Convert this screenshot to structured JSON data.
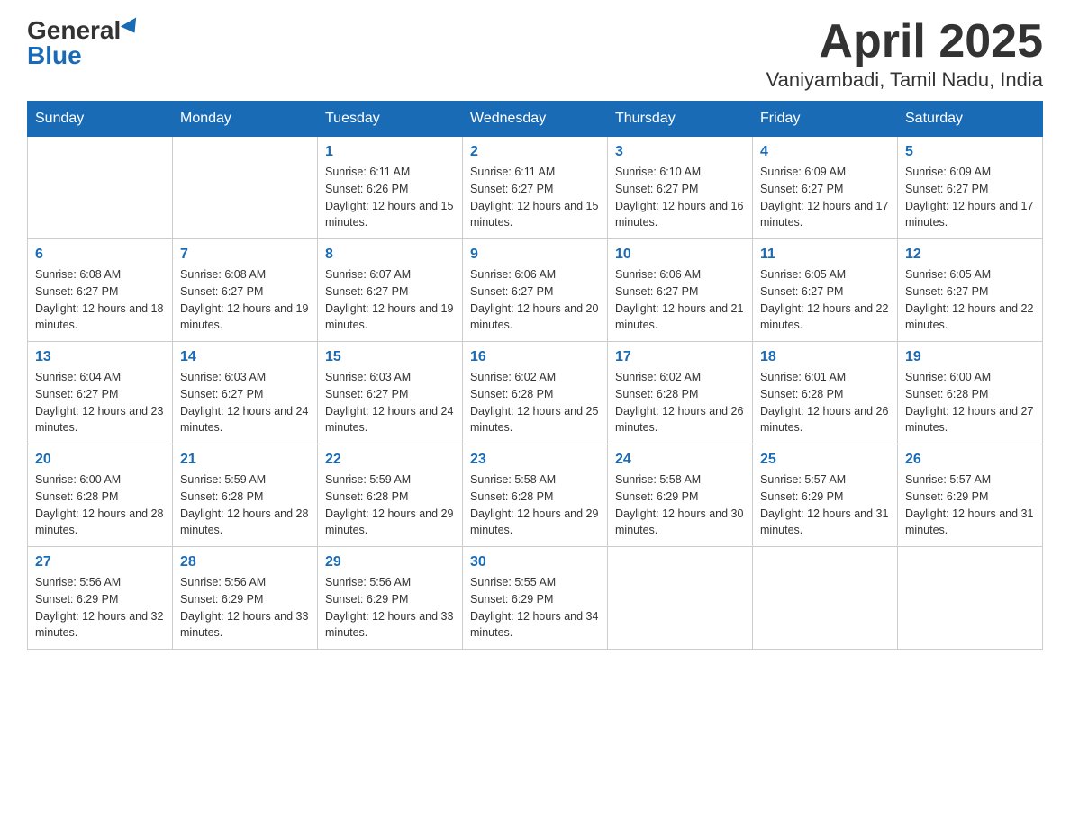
{
  "header": {
    "logo_general": "General",
    "logo_blue": "Blue",
    "month": "April 2025",
    "location": "Vaniyambadi, Tamil Nadu, India"
  },
  "weekdays": [
    "Sunday",
    "Monday",
    "Tuesday",
    "Wednesday",
    "Thursday",
    "Friday",
    "Saturday"
  ],
  "weeks": [
    [
      {
        "day": "",
        "sunrise": "",
        "sunset": "",
        "daylight": ""
      },
      {
        "day": "",
        "sunrise": "",
        "sunset": "",
        "daylight": ""
      },
      {
        "day": "1",
        "sunrise": "Sunrise: 6:11 AM",
        "sunset": "Sunset: 6:26 PM",
        "daylight": "Daylight: 12 hours and 15 minutes."
      },
      {
        "day": "2",
        "sunrise": "Sunrise: 6:11 AM",
        "sunset": "Sunset: 6:27 PM",
        "daylight": "Daylight: 12 hours and 15 minutes."
      },
      {
        "day": "3",
        "sunrise": "Sunrise: 6:10 AM",
        "sunset": "Sunset: 6:27 PM",
        "daylight": "Daylight: 12 hours and 16 minutes."
      },
      {
        "day": "4",
        "sunrise": "Sunrise: 6:09 AM",
        "sunset": "Sunset: 6:27 PM",
        "daylight": "Daylight: 12 hours and 17 minutes."
      },
      {
        "day": "5",
        "sunrise": "Sunrise: 6:09 AM",
        "sunset": "Sunset: 6:27 PM",
        "daylight": "Daylight: 12 hours and 17 minutes."
      }
    ],
    [
      {
        "day": "6",
        "sunrise": "Sunrise: 6:08 AM",
        "sunset": "Sunset: 6:27 PM",
        "daylight": "Daylight: 12 hours and 18 minutes."
      },
      {
        "day": "7",
        "sunrise": "Sunrise: 6:08 AM",
        "sunset": "Sunset: 6:27 PM",
        "daylight": "Daylight: 12 hours and 19 minutes."
      },
      {
        "day": "8",
        "sunrise": "Sunrise: 6:07 AM",
        "sunset": "Sunset: 6:27 PM",
        "daylight": "Daylight: 12 hours and 19 minutes."
      },
      {
        "day": "9",
        "sunrise": "Sunrise: 6:06 AM",
        "sunset": "Sunset: 6:27 PM",
        "daylight": "Daylight: 12 hours and 20 minutes."
      },
      {
        "day": "10",
        "sunrise": "Sunrise: 6:06 AM",
        "sunset": "Sunset: 6:27 PM",
        "daylight": "Daylight: 12 hours and 21 minutes."
      },
      {
        "day": "11",
        "sunrise": "Sunrise: 6:05 AM",
        "sunset": "Sunset: 6:27 PM",
        "daylight": "Daylight: 12 hours and 22 minutes."
      },
      {
        "day": "12",
        "sunrise": "Sunrise: 6:05 AM",
        "sunset": "Sunset: 6:27 PM",
        "daylight": "Daylight: 12 hours and 22 minutes."
      }
    ],
    [
      {
        "day": "13",
        "sunrise": "Sunrise: 6:04 AM",
        "sunset": "Sunset: 6:27 PM",
        "daylight": "Daylight: 12 hours and 23 minutes."
      },
      {
        "day": "14",
        "sunrise": "Sunrise: 6:03 AM",
        "sunset": "Sunset: 6:27 PM",
        "daylight": "Daylight: 12 hours and 24 minutes."
      },
      {
        "day": "15",
        "sunrise": "Sunrise: 6:03 AM",
        "sunset": "Sunset: 6:27 PM",
        "daylight": "Daylight: 12 hours and 24 minutes."
      },
      {
        "day": "16",
        "sunrise": "Sunrise: 6:02 AM",
        "sunset": "Sunset: 6:28 PM",
        "daylight": "Daylight: 12 hours and 25 minutes."
      },
      {
        "day": "17",
        "sunrise": "Sunrise: 6:02 AM",
        "sunset": "Sunset: 6:28 PM",
        "daylight": "Daylight: 12 hours and 26 minutes."
      },
      {
        "day": "18",
        "sunrise": "Sunrise: 6:01 AM",
        "sunset": "Sunset: 6:28 PM",
        "daylight": "Daylight: 12 hours and 26 minutes."
      },
      {
        "day": "19",
        "sunrise": "Sunrise: 6:00 AM",
        "sunset": "Sunset: 6:28 PM",
        "daylight": "Daylight: 12 hours and 27 minutes."
      }
    ],
    [
      {
        "day": "20",
        "sunrise": "Sunrise: 6:00 AM",
        "sunset": "Sunset: 6:28 PM",
        "daylight": "Daylight: 12 hours and 28 minutes."
      },
      {
        "day": "21",
        "sunrise": "Sunrise: 5:59 AM",
        "sunset": "Sunset: 6:28 PM",
        "daylight": "Daylight: 12 hours and 28 minutes."
      },
      {
        "day": "22",
        "sunrise": "Sunrise: 5:59 AM",
        "sunset": "Sunset: 6:28 PM",
        "daylight": "Daylight: 12 hours and 29 minutes."
      },
      {
        "day": "23",
        "sunrise": "Sunrise: 5:58 AM",
        "sunset": "Sunset: 6:28 PM",
        "daylight": "Daylight: 12 hours and 29 minutes."
      },
      {
        "day": "24",
        "sunrise": "Sunrise: 5:58 AM",
        "sunset": "Sunset: 6:29 PM",
        "daylight": "Daylight: 12 hours and 30 minutes."
      },
      {
        "day": "25",
        "sunrise": "Sunrise: 5:57 AM",
        "sunset": "Sunset: 6:29 PM",
        "daylight": "Daylight: 12 hours and 31 minutes."
      },
      {
        "day": "26",
        "sunrise": "Sunrise: 5:57 AM",
        "sunset": "Sunset: 6:29 PM",
        "daylight": "Daylight: 12 hours and 31 minutes."
      }
    ],
    [
      {
        "day": "27",
        "sunrise": "Sunrise: 5:56 AM",
        "sunset": "Sunset: 6:29 PM",
        "daylight": "Daylight: 12 hours and 32 minutes."
      },
      {
        "day": "28",
        "sunrise": "Sunrise: 5:56 AM",
        "sunset": "Sunset: 6:29 PM",
        "daylight": "Daylight: 12 hours and 33 minutes."
      },
      {
        "day": "29",
        "sunrise": "Sunrise: 5:56 AM",
        "sunset": "Sunset: 6:29 PM",
        "daylight": "Daylight: 12 hours and 33 minutes."
      },
      {
        "day": "30",
        "sunrise": "Sunrise: 5:55 AM",
        "sunset": "Sunset: 6:29 PM",
        "daylight": "Daylight: 12 hours and 34 minutes."
      },
      {
        "day": "",
        "sunrise": "",
        "sunset": "",
        "daylight": ""
      },
      {
        "day": "",
        "sunrise": "",
        "sunset": "",
        "daylight": ""
      },
      {
        "day": "",
        "sunrise": "",
        "sunset": "",
        "daylight": ""
      }
    ]
  ]
}
